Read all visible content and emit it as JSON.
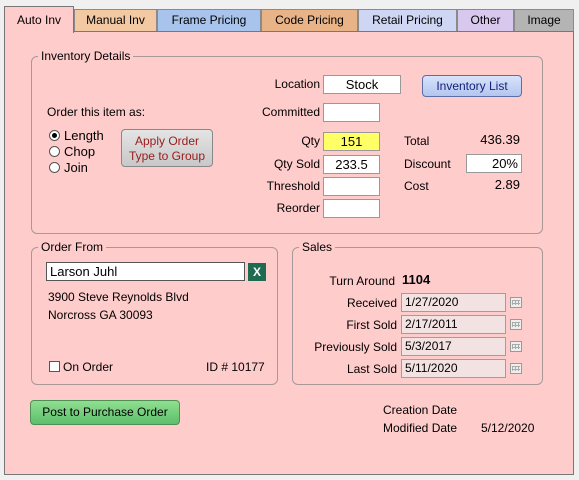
{
  "tabs": [
    {
      "label": "Auto Inv",
      "color": "#ffcccc"
    },
    {
      "label": "Manual Inv",
      "color": "#f2c9a3"
    },
    {
      "label": "Frame Pricing",
      "color": "#a9c4ec"
    },
    {
      "label": "Code Pricing",
      "color": "#e8b386"
    },
    {
      "label": "Retail Pricing",
      "color": "#cfd6f3"
    },
    {
      "label": "Other",
      "color": "#d9c8ee"
    },
    {
      "label": "Image",
      "color": "#b4b4b4"
    }
  ],
  "inventory": {
    "legend": "Inventory Details",
    "location_label": "Location",
    "location_value": "Stock",
    "inventory_list_button": "Inventory List",
    "committed_label": "Committed",
    "committed_value": "",
    "order_as_label": "Order this item as:",
    "radio": {
      "length": "Length",
      "chop": "Chop",
      "join": "Join",
      "selected": "length"
    },
    "apply_button_line1": "Apply Order",
    "apply_button_line2": "Type to Group",
    "qty_label": "Qty",
    "qty_value": "151",
    "qty_sold_label": "Qty Sold",
    "qty_sold_value": "233.5",
    "threshold_label": "Threshold",
    "threshold_value": "",
    "reorder_label": "Reorder",
    "reorder_value": "",
    "total_label": "Total",
    "total_value": "436.39",
    "discount_label": "Discount",
    "discount_value": "20%",
    "cost_label": "Cost",
    "cost_value": "2.89"
  },
  "order_from": {
    "legend": "Order From",
    "vendor": "Larson Juhl",
    "clear_icon": "X",
    "address1": "3900 Steve Reynolds Blvd",
    "address2": "Norcross GA 30093",
    "on_order_label": "On Order",
    "id_text": "ID # 10177"
  },
  "sales": {
    "legend": "Sales",
    "turn_around_label": "Turn Around",
    "turn_around_value": "1104",
    "received_label": "Received",
    "received_value": "1/27/2020",
    "first_sold_label": "First Sold",
    "first_sold_value": "2/17/2011",
    "previously_sold_label": "Previously Sold",
    "previously_sold_value": "5/3/2017",
    "last_sold_label": "Last Sold",
    "last_sold_value": "5/11/2020"
  },
  "footer": {
    "po_button": "Post to Purchase Order",
    "creation_label": "Creation Date",
    "creation_value": "",
    "modified_label": "Modified Date",
    "modified_value": "5/12/2020"
  }
}
